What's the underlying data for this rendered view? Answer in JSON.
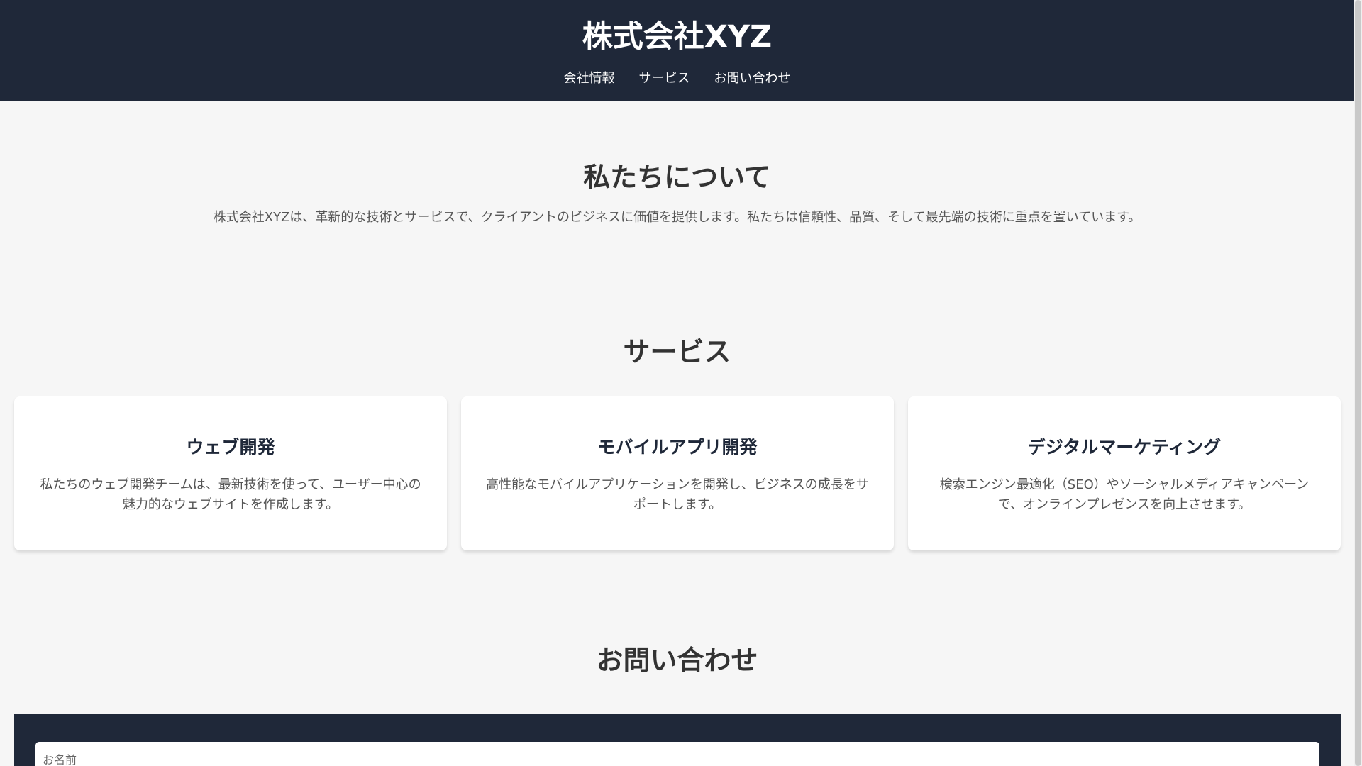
{
  "header": {
    "title": "株式会社XYZ",
    "nav": [
      "会社情報",
      "サービス",
      "お問い合わせ"
    ]
  },
  "about": {
    "heading": "私たちについて",
    "text": "株式会社XYZは、革新的な技術とサービスで、クライアントのビジネスに価値を提供します。私たちは信頼性、品質、そして最先端の技術に重点を置いています。"
  },
  "services": {
    "heading": "サービス",
    "cards": [
      {
        "title": "ウェブ開発",
        "text": "私たちのウェブ開発チームは、最新技術を使って、ユーザー中心の魅力的なウェブサイトを作成します。"
      },
      {
        "title": "モバイルアプリ開発",
        "text": "高性能なモバイルアプリケーションを開発し、ビジネスの成長をサポートします。"
      },
      {
        "title": "デジタルマーケティング",
        "text": "検索エンジン最適化（SEO）やソーシャルメディアキャンペーンで、オンラインプレゼンスを向上させます。"
      }
    ]
  },
  "contact": {
    "heading": "お問い合わせ",
    "name_placeholder": "お名前"
  },
  "colors": {
    "header_bg": "#1f2839",
    "page_bg": "#f6f6f6",
    "card_title": "#1f2839"
  }
}
